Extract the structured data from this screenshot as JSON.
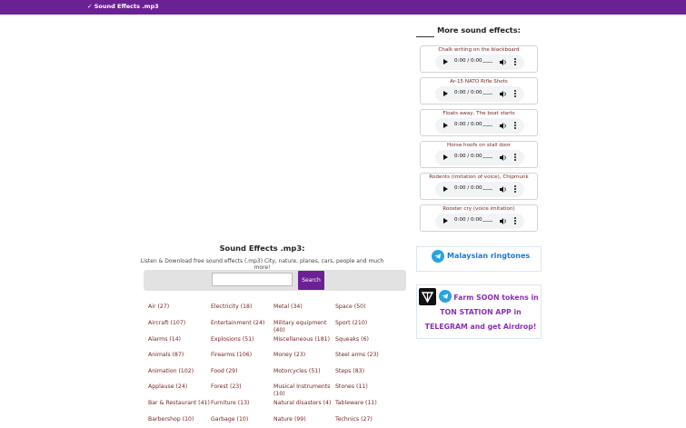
{
  "header": {
    "brand": "✓ Sound Effects .mp3"
  },
  "intro": {
    "title": "Sound Effects .mp3:",
    "text": "Listen & Download free sound effects (.mp3) City, nature, planes, cars, people and much more!"
  },
  "search": {
    "placeholder": "",
    "value": "",
    "button_label": "Search"
  },
  "categories": [
    [
      "Air (27)",
      "Electricity (18)",
      "Metal (34)",
      "Space (50)"
    ],
    [
      "Aircraft (107)",
      "Entertainment (24)",
      "Military equipment (40)",
      "Sport (210)"
    ],
    [
      "Alarms (14)",
      "Explosions (51)",
      "Miscellaneous (181)",
      "Squeaks (6)"
    ],
    [
      "Animals (87)",
      "Firearms (106)",
      "Money (23)",
      "Steel arms (23)"
    ],
    [
      "Animation (102)",
      "Food (29)",
      "Motorcycles (51)",
      "Steps (83)"
    ],
    [
      "Applause (24)",
      "Forest (23)",
      "Musical Instruments (10)",
      "Stones (11)"
    ],
    [
      "Bar & Restaurant (41)",
      "Furniture (13)",
      "Natural disasters (4)",
      "Tableware (11)"
    ],
    [
      "Barbershop (10)",
      "Garbage (10)",
      "Nature (99)",
      "Technics (27)"
    ]
  ],
  "sidebar": {
    "title": "More sound effects:",
    "sounds": [
      {
        "name": "Chalk writing on the blackboard",
        "time": "0:00 / 0:00"
      },
      {
        "name": "Ar-15 NATO Rifle Shots",
        "time": "0:00 / 0:00"
      },
      {
        "name": "Floats away, The boat starts",
        "time": "0:00 / 0:00"
      },
      {
        "name": "Horse hoofs on stall door",
        "time": "0:00 / 0:00"
      },
      {
        "name": "Rodents (imitation of voice), Chipmunk",
        "time": "0:00 / 0:00"
      },
      {
        "name": "Rooster cry (voice imitation)",
        "time": "0:00 / 0:00"
      }
    ]
  },
  "ringtones": {
    "label": "Malaysian ringtones"
  },
  "promo": {
    "text": "Farm SOON tokens in TON STATION APP in TELEGRAM and get Airdrop!"
  },
  "colors": {
    "brand": "#6b2193",
    "link": "#7a2424",
    "telegram": "#2aa3df",
    "promo": "#8b2fb5"
  }
}
